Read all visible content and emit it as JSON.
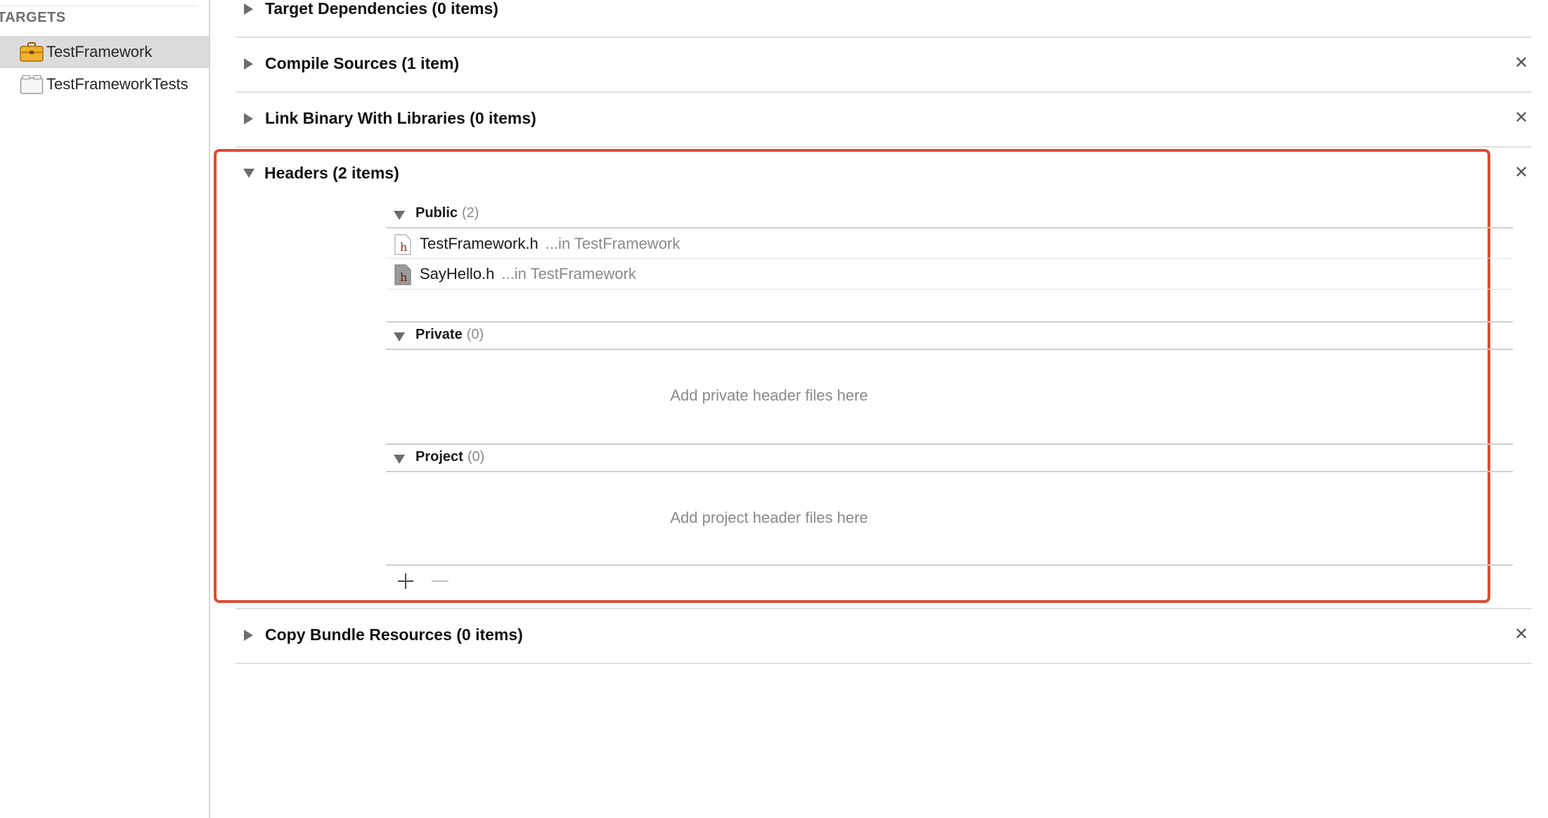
{
  "sidebar": {
    "header": "TARGETS",
    "items": [
      {
        "label": "TestFramework",
        "icon": "framework-toolbox-icon",
        "selected": true
      },
      {
        "label": "TestFrameworkTests",
        "icon": "test-bundle-icon",
        "selected": false
      }
    ]
  },
  "phases": {
    "target_dependencies": "Target Dependencies (0 items)",
    "compile_sources": "Compile Sources (1 item)",
    "link_binary": "Link Binary With Libraries (0 items)",
    "headers": "Headers (2 items)",
    "copy_bundle": "Copy Bundle Resources (0 items)",
    "close_glyph": "✕"
  },
  "headers": {
    "public": {
      "name": "Public",
      "count": "(2)",
      "files": [
        {
          "name": "TestFramework.h",
          "location": "...in TestFramework",
          "icon": "header-file-icon"
        },
        {
          "name": "SayHello.h",
          "location": "...in TestFramework",
          "icon": "header-file-icon"
        }
      ]
    },
    "private": {
      "name": "Private",
      "count": "(0)",
      "placeholder": "Add private header files here"
    },
    "project": {
      "name": "Project",
      "count": "(0)",
      "placeholder": "Add project header files here"
    }
  },
  "colors": {
    "highlight": "#de4b33",
    "selection": "#dcdcdc"
  }
}
